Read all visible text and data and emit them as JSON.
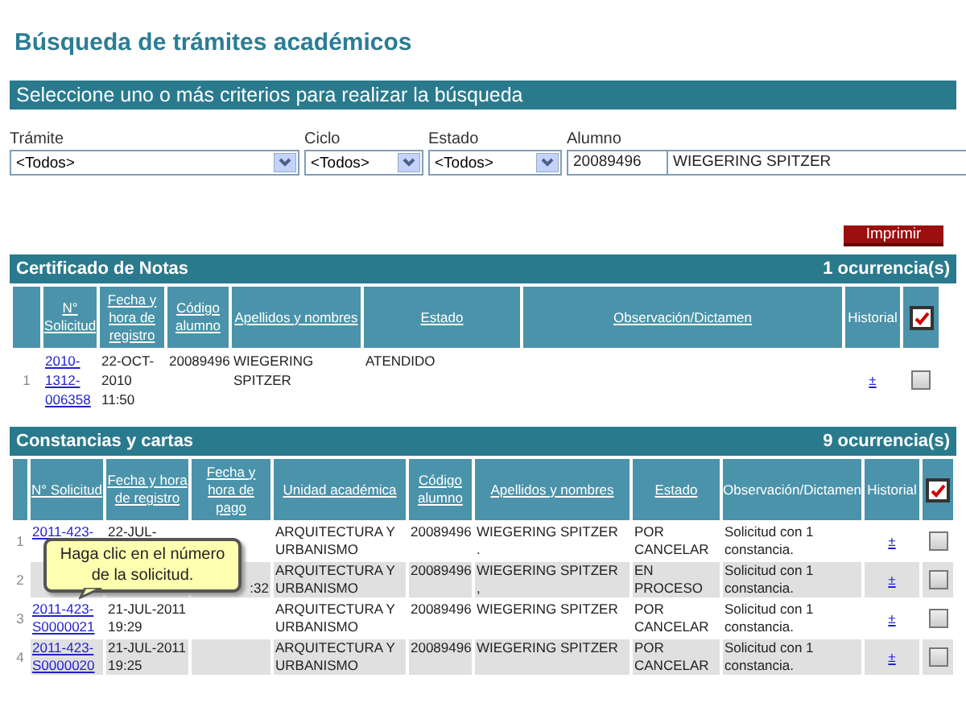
{
  "title": "Búsqueda de trámites académicos",
  "criteria_bar": "Seleccione uno o más criterios para realizar la búsqueda",
  "filters": [
    {
      "label": "Trámite",
      "kind": "select",
      "value": "<Todos>"
    },
    {
      "label": "Ciclo",
      "kind": "select",
      "value": "<Todos>"
    },
    {
      "label": "Estado",
      "kind": "select",
      "value": "<Todos>"
    },
    {
      "label": "Alumno",
      "kind": "text",
      "value": "20089496",
      "value2": "WIEGERING SPITZER"
    }
  ],
  "print_button": "Imprimir",
  "sections": [
    {
      "title": "Certificado de Notas",
      "count": "1 ocurrencia(s)",
      "select_all_checked": true,
      "columns": [
        {
          "label": "N° Solicitud",
          "link": true
        },
        {
          "label": "Fecha y hora de registro",
          "link": true
        },
        {
          "label": "Código alumno",
          "link": true
        },
        {
          "label": "Apellidos y nombres",
          "link": true
        },
        {
          "label": "Estado",
          "link": true
        },
        {
          "label": "Observación/Dictamen",
          "link": true
        },
        {
          "label": "Historial",
          "link": false
        }
      ],
      "rows": [
        {
          "index": "1",
          "cells": [
            "2010-1312-006358",
            "22-OCT-2010 11:50",
            "20089496",
            "WIEGERING SPITZER",
            "ATENDIDO",
            ""
          ],
          "history": "±",
          "checked": false
        }
      ]
    },
    {
      "title": "Constancias y cartas",
      "count": "9 ocurrencia(s)",
      "select_all_checked": true,
      "columns": [
        {
          "label": "N° Solicitud",
          "link": true
        },
        {
          "label": "Fecha y hora de registro",
          "link": true
        },
        {
          "label": "Fecha y hora de pago",
          "link": true
        },
        {
          "label": "Unidad académica",
          "link": true
        },
        {
          "label": "Código alumno",
          "link": true
        },
        {
          "label": "Apellidos y nombres",
          "link": true
        },
        {
          "label": "Estado",
          "link": true
        },
        {
          "label": "Observación/Dictamen",
          "link": false
        },
        {
          "label": "Historial",
          "link": false
        }
      ],
      "rows": [
        {
          "index": "1",
          "cells": [
            "2011-423-",
            "22-JUL-",
            "",
            "ARQUITECTURA Y URBANISMO",
            "20089496",
            "WIEGERING SPITZER\n.",
            "POR CANCELAR",
            "Solicitud con 1 constancia."
          ],
          "history": "±",
          "checked": false
        },
        {
          "index": "2",
          "cells": [
            "",
            "",
            ":32",
            "ARQUITECTURA Y URBANISMO",
            "20089496",
            "WIEGERING SPITZER\n,",
            "EN PROCESO",
            "Solicitud con 1 constancia."
          ],
          "history": "±",
          "checked": false
        },
        {
          "index": "3",
          "cells": [
            "2011-423-S0000021",
            "21-JUL-2011 19:29",
            "",
            "ARQUITECTURA Y URBANISMO",
            "20089496",
            "WIEGERING SPITZER",
            "POR CANCELAR",
            "Solicitud con 1 constancia."
          ],
          "history": "±",
          "checked": false
        },
        {
          "index": "4",
          "cells": [
            "2011-423-S0000020",
            "21-JUL-2011 19:25",
            "",
            "ARQUITECTURA Y URBANISMO",
            "20089496",
            "WIEGERING SPITZER",
            "POR CANCELAR",
            "Solicitud con 1 constancia."
          ],
          "history": "±",
          "checked": false
        }
      ]
    }
  ],
  "tooltip": "Haga clic en el número de la solicitud."
}
